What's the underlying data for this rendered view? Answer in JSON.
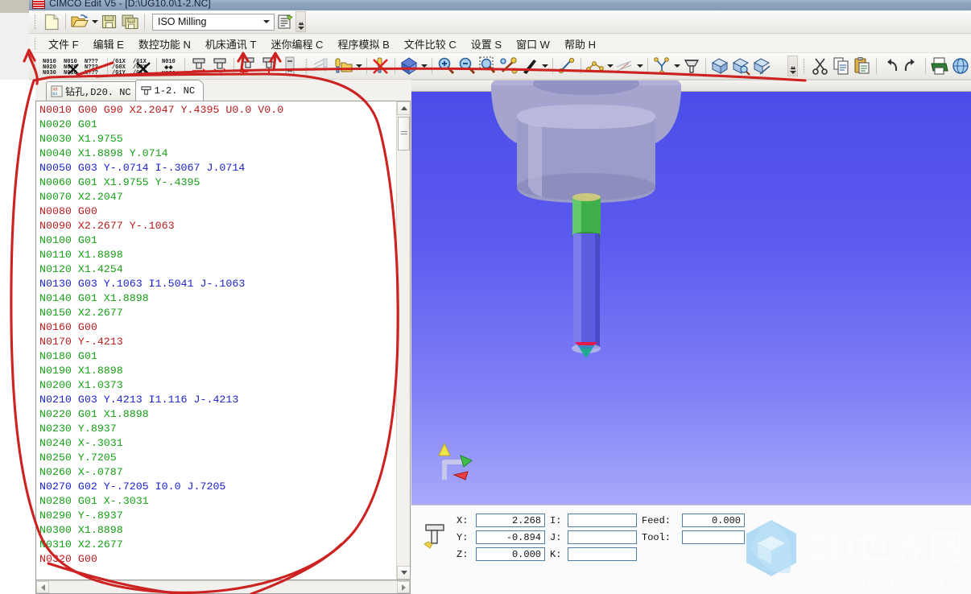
{
  "window": {
    "title": "CIMCO Edit V5 - [D:\\UG10.0\\1-2.NC]",
    "app_icon": "cimco-icon"
  },
  "toolbar_top": {
    "combo_value": "ISO Milling",
    "buttons": [
      {
        "name": "new-file-button",
        "icon": "new-document-icon"
      },
      {
        "name": "open-file-button",
        "icon": "open-folder-icon"
      },
      {
        "name": "save-file-button",
        "icon": "floppy-save-icon"
      },
      {
        "name": "save-all-button",
        "icon": "floppy-save-all-icon"
      },
      {
        "name": "file-properties-button",
        "icon": "properties-icon"
      }
    ]
  },
  "menu": {
    "items": [
      {
        "label": "文件 F",
        "name": "menu-file"
      },
      {
        "label": "编辑 E",
        "name": "menu-edit"
      },
      {
        "label": "数控功能 N",
        "name": "menu-nc-functions"
      },
      {
        "label": "机床通讯 T",
        "name": "menu-machine-comm"
      },
      {
        "label": "迷你编程 C",
        "name": "menu-mini-program"
      },
      {
        "label": "程序模拟 B",
        "name": "menu-backplot"
      },
      {
        "label": "文件比较 C",
        "name": "menu-file-compare"
      },
      {
        "label": "设置 S",
        "name": "menu-settings"
      },
      {
        "label": "窗口 W",
        "name": "menu-window"
      },
      {
        "label": "帮助 H",
        "name": "menu-help"
      }
    ]
  },
  "toolbar_nc": {
    "buttons": [
      {
        "name": "renumber-button",
        "icon": "renumber-icon",
        "caption": "N010 N020 N030"
      },
      {
        "name": "remove-numbers-button",
        "icon": "remove-numbers-icon",
        "caption": "N010 N0x0"
      },
      {
        "name": "block-numbers-button",
        "icon": "unknown-numbers-icon",
        "caption": "N??? N??? N???"
      },
      {
        "name": "insert-gcode-button",
        "icon": "g1x-g0x-g1y-icon",
        "caption": "/G1X /G0X /G1Y"
      },
      {
        "name": "remove-gcode-button",
        "icon": "remove-g1x-icon",
        "caption": "/G1X"
      },
      {
        "name": "sort-numbers-button",
        "icon": "sort-n010-icon",
        "caption": "N010 ** N030"
      },
      {
        "name": "tool-compensation-right-button",
        "icon": "tool-arrow-right-icon"
      },
      {
        "name": "tool-compensation-arc-button",
        "icon": "tool-arrow-arc-icon"
      },
      {
        "name": "tool-start-button",
        "icon": "tool-plus-icon"
      },
      {
        "name": "tool-end-button",
        "icon": "tool-up-arrow-icon"
      },
      {
        "name": "tool-list-button",
        "icon": "tool-list-icon"
      },
      {
        "name": "mirror-tool-button",
        "icon": "mirror-tool-icon"
      },
      {
        "name": "tool-library-button",
        "icon": "tool-library-icon"
      },
      {
        "name": "delete-tool-button",
        "icon": "delete-tool-icon"
      },
      {
        "name": "solid-view-button",
        "icon": "solid-cube-icon"
      },
      {
        "name": "zoom-in-button",
        "icon": "zoom-in-icon"
      },
      {
        "name": "zoom-out-button",
        "icon": "zoom-out-icon"
      },
      {
        "name": "zoom-window-button",
        "icon": "zoom-window-icon"
      },
      {
        "name": "zoom-fit-button",
        "icon": "zoom-fit-icon"
      },
      {
        "name": "pan-button",
        "icon": "pan-hand-icon"
      },
      {
        "name": "measure-button",
        "icon": "measure-icon"
      },
      {
        "name": "polyline-button",
        "icon": "polyline-icon"
      },
      {
        "name": "surface-button",
        "icon": "surface-icon"
      },
      {
        "name": "node-tree-button",
        "icon": "node-tree-icon"
      },
      {
        "name": "tool-setup-button",
        "icon": "tool-setup-icon"
      },
      {
        "name": "solid-sim-button",
        "icon": "solid-sim-icon"
      },
      {
        "name": "solid-sim-zoom-button",
        "icon": "solid-sim-zoom-icon"
      },
      {
        "name": "solid-sim-section-button",
        "icon": "solid-sim-section-icon"
      },
      {
        "name": "cut-button",
        "icon": "scissors-icon"
      },
      {
        "name": "copy-button",
        "icon": "copy-icon"
      },
      {
        "name": "paste-button",
        "icon": "paste-icon"
      },
      {
        "name": "undo-button",
        "icon": "undo-arrow-icon"
      },
      {
        "name": "redo-button",
        "icon": "redo-arrow-icon"
      },
      {
        "name": "print-button",
        "icon": "printer-icon"
      },
      {
        "name": "help-button",
        "icon": "help-globe-icon"
      }
    ]
  },
  "tabs": [
    {
      "label": "钻孔,D20. NC",
      "name": "tab-drill-d20",
      "icon": "gcode-file-icon",
      "active": false
    },
    {
      "label": "1-2. NC",
      "name": "tab-1-2-nc",
      "icon": "tool-file-icon",
      "active": true
    }
  ],
  "editor": {
    "lines": [
      {
        "text": "N0010 G00 G90 X2.2047 Y.4395 U0.0 V0.0",
        "color": "red"
      },
      {
        "text": "N0020 G01",
        "color": "green"
      },
      {
        "text": "N0030 X1.9755",
        "color": "green"
      },
      {
        "text": "N0040 X1.8898 Y.0714",
        "color": "green"
      },
      {
        "text": "N0050 G03 Y-.0714 I-.3067 J.0714",
        "color": "blue"
      },
      {
        "text": "N0060 G01 X1.9755 Y-.4395",
        "color": "green"
      },
      {
        "text": "N0070 X2.2047",
        "color": "green"
      },
      {
        "text": "N0080 G00",
        "color": "red"
      },
      {
        "text": "N0090 X2.2677 Y-.1063",
        "color": "red"
      },
      {
        "text": "N0100 G01",
        "color": "green"
      },
      {
        "text": "N0110 X1.8898",
        "color": "green"
      },
      {
        "text": "N0120 X1.4254",
        "color": "green"
      },
      {
        "text": "N0130 G03 Y.1063 I1.5041 J-.1063",
        "color": "blue"
      },
      {
        "text": "N0140 G01 X1.8898",
        "color": "green"
      },
      {
        "text": "N0150 X2.2677",
        "color": "green"
      },
      {
        "text": "N0160 G00",
        "color": "red"
      },
      {
        "text": "N0170 Y-.4213",
        "color": "red"
      },
      {
        "text": "N0180 G01",
        "color": "green"
      },
      {
        "text": "N0190 X1.8898",
        "color": "green"
      },
      {
        "text": "N0200 X1.0373",
        "color": "green"
      },
      {
        "text": "N0210 G03 Y.4213 I1.116 J-.4213",
        "color": "blue"
      },
      {
        "text": "N0220 G01 X1.8898",
        "color": "green"
      },
      {
        "text": "N0230 Y.8937",
        "color": "green"
      },
      {
        "text": "N0240 X-.3031",
        "color": "green"
      },
      {
        "text": "N0250 Y.7205",
        "color": "green"
      },
      {
        "text": "N0260 X-.0787",
        "color": "green"
      },
      {
        "text": "N0270 G02 Y-.7205 I0.0 J.7205",
        "color": "blue"
      },
      {
        "text": "N0280 G01 X-.3031",
        "color": "green"
      },
      {
        "text": "N0290 Y-.8937",
        "color": "green"
      },
      {
        "text": "N0300 X1.8898",
        "color": "green"
      },
      {
        "text": "N0310 X2.2677",
        "color": "green"
      },
      {
        "text": "N0320 G00",
        "color": "red"
      }
    ],
    "colors": {
      "red": "#b81b1b",
      "green": "#17a017",
      "blue": "#1b23c8"
    }
  },
  "status": {
    "labels": {
      "x": "X:",
      "y": "Y:",
      "z": "Z:",
      "i": "I:",
      "j": "J:",
      "k": "K:",
      "feed": "Feed:",
      "tool": "Tool:"
    },
    "values": {
      "x": "2.268",
      "y": "-0.894",
      "z": "0.000",
      "i": "",
      "j": "",
      "k": "",
      "feed": "0.000",
      "tool": ""
    }
  },
  "watermark": {
    "text": "3D世界网",
    "url": "WWW.3DSJW.COM",
    "logo": "3d-cube-hexagon-icon"
  },
  "viewport": {
    "background_top": "#4b4be8",
    "background_bottom": "#a8a8fa",
    "axis_gizmo": "xyz-axis-gizmo-icon",
    "tool_holder_color": "#9a9ac8",
    "tool_shank_color": "#5c5ce0",
    "tool_collar_color": "#3faf4a"
  },
  "annotation": {
    "color": "#cc2222",
    "shape": "hand-drawn-red-circle-and-arrows"
  }
}
